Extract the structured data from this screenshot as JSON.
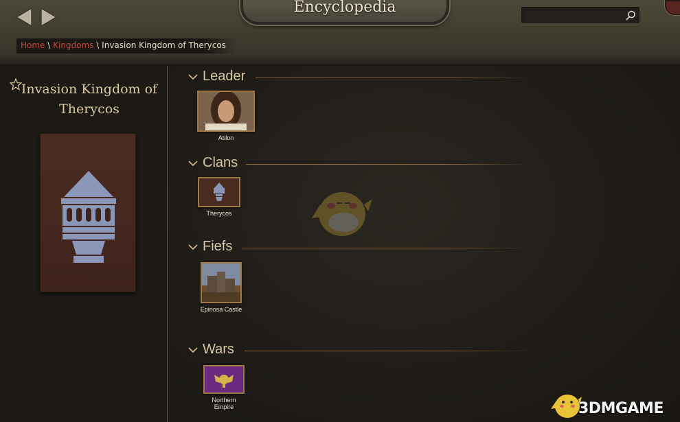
{
  "header": {
    "title": "Encyclopedia",
    "search": {
      "value": "",
      "placeholder": ""
    }
  },
  "breadcrumb": {
    "items": [
      "Home",
      "Kingdoms"
    ],
    "separator": "\\",
    "current": "Invasion Kingdom of Therycos"
  },
  "kingdom": {
    "name": "Invasion Kingdom of Therycos",
    "banner_color": "#4a2b20",
    "emblem_color": "#8a97b8"
  },
  "sections": {
    "leader": {
      "label": "Leader",
      "items": [
        {
          "name": "Atilon"
        }
      ]
    },
    "clans": {
      "label": "Clans",
      "items": [
        {
          "name": "Therycos"
        }
      ]
    },
    "fiefs": {
      "label": "Fiefs",
      "items": [
        {
          "name": "Epinosa Castle"
        }
      ]
    },
    "wars": {
      "label": "Wars",
      "items": [
        {
          "name": "Northern Empire"
        }
      ]
    }
  },
  "watermark": {
    "text": "3DMGAME"
  },
  "colors": {
    "accent_gold": "#a07a46",
    "link_red": "#c4493a",
    "war_banner": "#6a2a7e"
  }
}
